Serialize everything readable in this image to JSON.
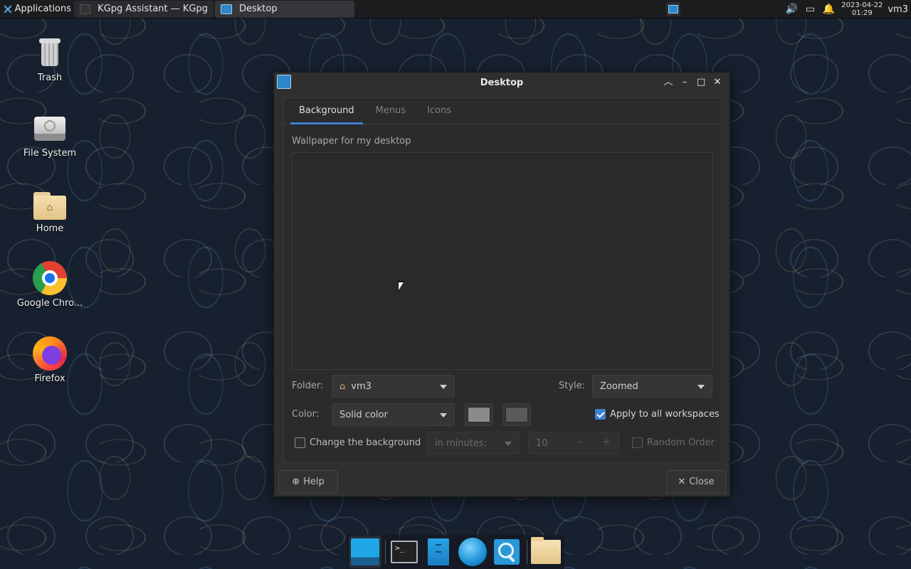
{
  "panel": {
    "apps_label": "Applications",
    "tasks": [
      {
        "label": "KGpg Assistant — KGpg"
      },
      {
        "label": "Desktop"
      }
    ],
    "clock_date": "2023-04-22",
    "clock_time": "01:29",
    "user": "vm3"
  },
  "desktop_icons": [
    {
      "label": "Trash"
    },
    {
      "label": "File System"
    },
    {
      "label": "Home"
    },
    {
      "label": "Google Chro..."
    },
    {
      "label": "Firefox"
    }
  ],
  "dialog": {
    "title": "Desktop",
    "tabs": [
      {
        "label": "Background",
        "active": true
      },
      {
        "label": "Menus",
        "active": false
      },
      {
        "label": "Icons",
        "active": false
      }
    ],
    "wallpaper_label": "Wallpaper for my desktop",
    "folder_label": "Folder:",
    "folder_value": "vm3",
    "style_label": "Style:",
    "style_value": "Zoomed",
    "color_label": "Color:",
    "color_value": "Solid color",
    "color1": "#8a8a8a",
    "color2": "#5a5a5a",
    "apply_all_label": "Apply to all workspaces",
    "apply_all_checked": true,
    "change_bg_label": "Change the background",
    "change_bg_checked": false,
    "interval_unit": "in minutes:",
    "interval_value": "10",
    "random_order_label": "Random Order",
    "random_order_checked": false,
    "help_label": "Help",
    "close_label": "Close"
  },
  "colors": {
    "accent": "#3d7fd1"
  }
}
